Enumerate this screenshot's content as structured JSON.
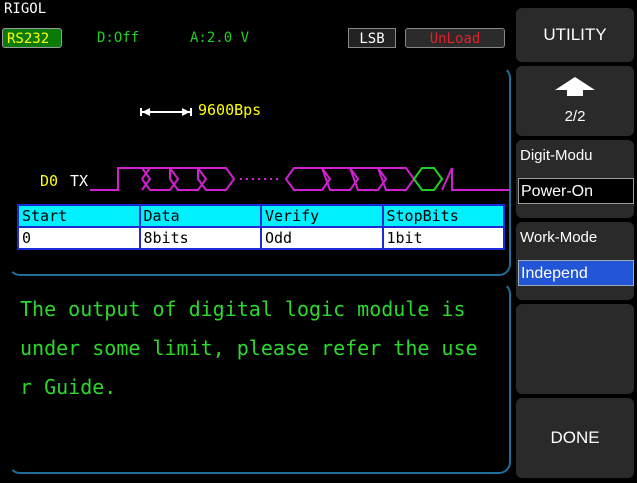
{
  "brand": "RIGOL",
  "status": {
    "mode": "RS232",
    "digital": "D:Off",
    "amplitude": "A:2.0 V",
    "bit_order": "LSB",
    "load": "UnLoad"
  },
  "signal": {
    "baud": "9600Bps",
    "channel": "D0",
    "signal_name": "TX"
  },
  "params": {
    "headers": [
      "Start",
      "Data",
      "Verify",
      "StopBits"
    ],
    "values": [
      "0",
      "8bits",
      "Odd",
      "1bit"
    ]
  },
  "message": "The output of digital logic module is under some limit, please refer the user Guide.",
  "message_lines": [
    "The output of digital logic module is",
    "under some limit, please refer the use",
    "r Guide."
  ],
  "softkeys": {
    "utility": "UTILITY",
    "page": "2/2",
    "digit_modu_title": "Digit-Modu",
    "digit_modu_value": "Power-On",
    "work_mode_title": "Work-Mode",
    "work_mode_value": "Independ",
    "done": "DONE"
  },
  "colors": {
    "accent_yellow": "#ffff00",
    "header_cyan": "#00f0ff",
    "table_border": "#1b2bd8",
    "message_green": "#2cd82c",
    "wave_magenta": "#d020d0",
    "wave_green": "#20d020",
    "selected_blue": "#2356d6"
  }
}
